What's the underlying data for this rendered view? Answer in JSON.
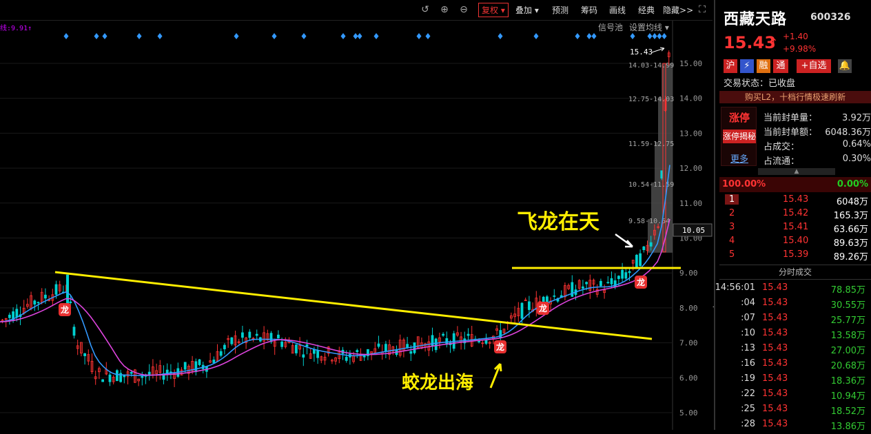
{
  "toolbar": {
    "fuquan": "复权",
    "diejia": "叠加",
    "yuce": "预测",
    "chouma": "筹码",
    "huaxian": "画线",
    "jingdian": "经典",
    "yincang": "隐藏",
    "more": ">>"
  },
  "ma_label": "线:9.91↑",
  "signal_pool": "信号池",
  "set_ma": "设置均线",
  "chart_data": {
    "type": "candlestick",
    "y_ticks": [
      "15.00",
      "14.00",
      "13.00",
      "12.00",
      "11.00",
      "10.00",
      "9.00",
      "8.00",
      "7.00",
      "6.00",
      "5.00"
    ],
    "price_label_top": "15.43",
    "current_price_tag": "10.05",
    "chip_labels": [
      "14.03-14.99",
      "12.75-14.03",
      "11.59-12.75",
      "10.54-11.59",
      "9.58-10.54"
    ],
    "annotations": {
      "feilong": "飞龙在天",
      "jiaolong": "蛟龙出海",
      "long_badge": "龙"
    },
    "colors": {
      "up": "#ff3333",
      "down": "#00d0d0",
      "ma_fast": "#3399ff",
      "ma_slow": "#dd44dd",
      "trendline": "#ffee00",
      "diamond": "#3399ff"
    }
  },
  "stock": {
    "name": "西藏天路",
    "code": "600326",
    "price": "15.43",
    "arrow": "↑",
    "change": "+1.40",
    "change_pct": "+9.98%"
  },
  "badges": [
    "沪",
    "⚡",
    "融",
    "通",
    "+自选"
  ],
  "trade_status": "交易状态：已收盘",
  "l2_banner": "购买L2，十档行情极速刷新",
  "zt": {
    "title": "涨停",
    "reveal": "涨停揭秘",
    "more": "更多"
  },
  "stats": [
    {
      "label": "当前封单量：",
      "value": "3.92万"
    },
    {
      "label": "当前封单额：",
      "value": "6048.36万"
    },
    {
      "label": "占成交：",
      "value": "0.64%"
    },
    {
      "label": "占流通：",
      "value": "0.30%"
    }
  ],
  "ratio": {
    "left": "100.00%",
    "right": "0.00%"
  },
  "bids": [
    {
      "level": "1",
      "price": "15.43",
      "volume": "6048万"
    },
    {
      "level": "2",
      "price": "15.42",
      "volume": "165.3万"
    },
    {
      "level": "3",
      "price": "15.41",
      "volume": "63.66万"
    },
    {
      "level": "4",
      "price": "15.40",
      "volume": "89.63万"
    },
    {
      "level": "5",
      "price": "15.39",
      "volume": "89.26万"
    }
  ],
  "tick_header": "分时成交",
  "ticks": [
    {
      "time": "14:56:01",
      "price": "15.43",
      "vol": "78.85万"
    },
    {
      "time": ":04",
      "price": "15.43",
      "vol": "30.55万"
    },
    {
      "time": ":07",
      "price": "15.43",
      "vol": "25.77万"
    },
    {
      "time": ":10",
      "price": "15.43",
      "vol": "13.58万"
    },
    {
      "time": ":13",
      "price": "15.43",
      "vol": "27.00万"
    },
    {
      "time": ":16",
      "price": "15.43",
      "vol": "20.68万"
    },
    {
      "time": ":19",
      "price": "15.43",
      "vol": "18.36万"
    },
    {
      "time": ":22",
      "price": "15.43",
      "vol": "10.94万"
    },
    {
      "time": ":25",
      "price": "15.43",
      "vol": "18.52万"
    },
    {
      "time": ":28",
      "price": "15.43",
      "vol": "13.86万"
    }
  ]
}
